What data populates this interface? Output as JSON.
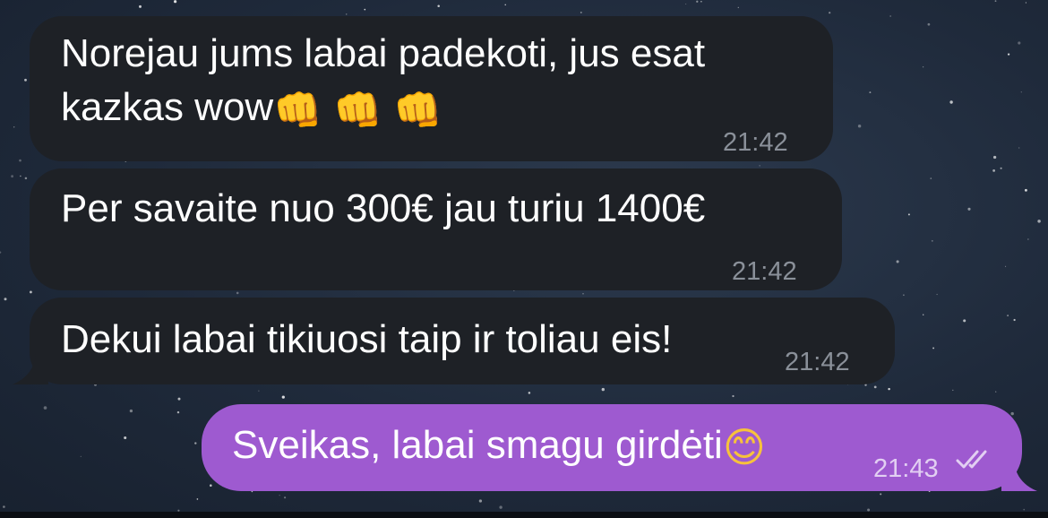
{
  "messages": [
    {
      "direction": "incoming",
      "line1": "Norejau jums labai padekoti, jus esat",
      "line2": "kazkas wow",
      "emojis": [
        "oncoming-fist",
        "oncoming-fist",
        "oncoming-fist"
      ],
      "emoji_glyph": "👊",
      "time": "21:42"
    },
    {
      "direction": "incoming",
      "text": "Per savaite nuo 300€ jau turiu 1400€",
      "time": "21:42"
    },
    {
      "direction": "incoming",
      "text": "Dekui labai tikiuosi taip ir toliau eis!",
      "time": "21:42"
    },
    {
      "direction": "outgoing",
      "text": "Sveikas, labai smagu girdėti",
      "emoji": "smiling-face",
      "emoji_glyph": "😊",
      "time": "21:43",
      "status": "read-double-check"
    }
  ],
  "colors": {
    "incoming_bubble": "#1e2126",
    "outgoing_bubble": "#9e5ad0",
    "background": "#1f2a3b"
  }
}
